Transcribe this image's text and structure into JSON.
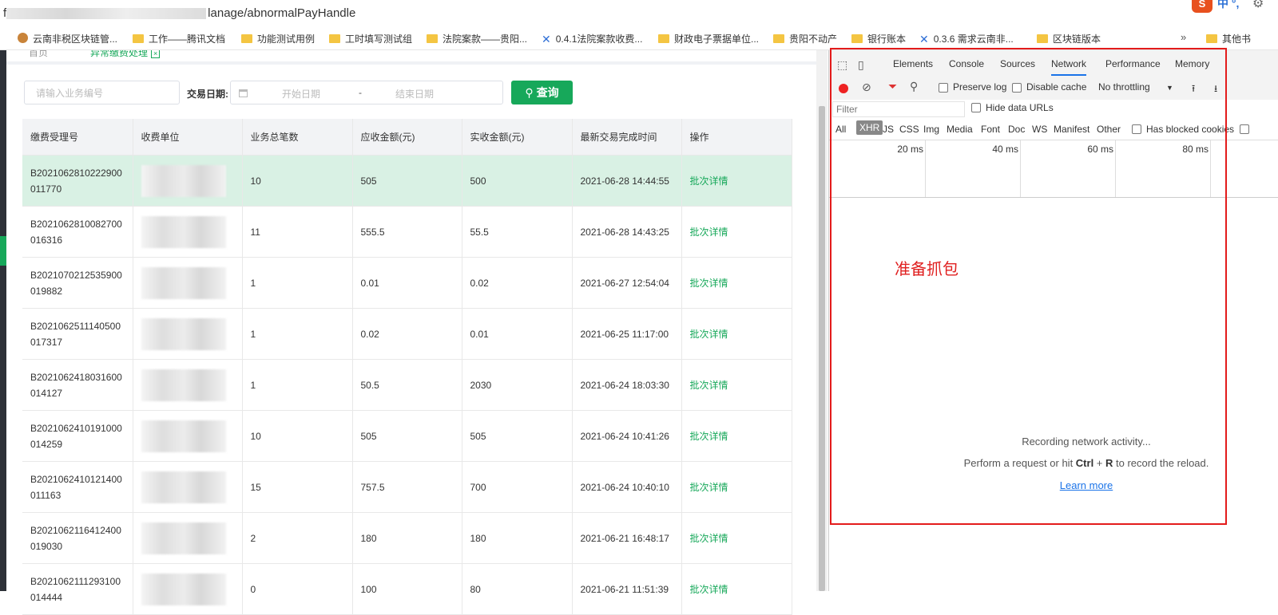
{
  "address_bar": {
    "url_prefix": "f",
    "url_suffix": "lanage/abnormalPayHandle"
  },
  "extension_icons": {
    "sogou": "S",
    "ime": "中 °,",
    "gear": "⚙"
  },
  "bookmarks": [
    {
      "label": "云南非税区块链管...",
      "icon": "circle"
    },
    {
      "label": "工作——腾讯文档",
      "icon": "folder"
    },
    {
      "label": "功能测试用例",
      "icon": "folder"
    },
    {
      "label": "工时填写测试组",
      "icon": "folder"
    },
    {
      "label": "法院案款——贵阳...",
      "icon": "folder"
    },
    {
      "label": "0.4.1法院案款收费...",
      "icon": "jira"
    },
    {
      "label": "财政电子票据单位...",
      "icon": "folder"
    },
    {
      "label": "贵阳不动产",
      "icon": "folder"
    },
    {
      "label": "银行账本",
      "icon": "folder"
    },
    {
      "label": "0.3.6 需求云南非...",
      "icon": "jira"
    },
    {
      "label": "区块链版本",
      "icon": "folder"
    },
    {
      "label": "其他书",
      "icon": "folder"
    }
  ],
  "bookmarks_more": "»",
  "page_tabs": {
    "home": "首页",
    "current": "异常缴费处理",
    "close": "×"
  },
  "filters": {
    "biz_no_placeholder": "请输入业务编号",
    "date_label": "交易日期:",
    "start_placeholder": "开始日期",
    "separator": "-",
    "end_placeholder": "结束日期",
    "query_button": "查询"
  },
  "table": {
    "headers": [
      "缴费受理号",
      "收费单位",
      "业务总笔数",
      "应收金额(元)",
      "实收金额(元)",
      "最新交易完成时间",
      "操作"
    ],
    "rows": [
      {
        "id": [
          "B2021062810222900",
          "011770"
        ],
        "count": "10",
        "due": "505",
        "paid": "500",
        "time": "2021-06-28 14:44:55",
        "op": "批次详情",
        "selected": true
      },
      {
        "id": [
          "B2021062810082700",
          "016316"
        ],
        "count": "11",
        "due": "555.5",
        "paid": "55.5",
        "time": "2021-06-28 14:43:25",
        "op": "批次详情"
      },
      {
        "id": [
          "B2021070212535900",
          "019882"
        ],
        "count": "1",
        "due": "0.01",
        "paid": "0.02",
        "time": "2021-06-27 12:54:04",
        "op": "批次详情"
      },
      {
        "id": [
          "B2021062511140500",
          "017317"
        ],
        "count": "1",
        "due": "0.02",
        "paid": "0.01",
        "time": "2021-06-25 11:17:00",
        "op": "批次详情"
      },
      {
        "id": [
          "B2021062418031600",
          "014127"
        ],
        "count": "1",
        "due": "50.5",
        "paid": "2030",
        "time": "2021-06-24 18:03:30",
        "op": "批次详情"
      },
      {
        "id": [
          "B2021062410191000",
          "014259"
        ],
        "count": "10",
        "due": "505",
        "paid": "505",
        "time": "2021-06-24 10:41:26",
        "op": "批次详情"
      },
      {
        "id": [
          "B2021062410121400",
          "011163"
        ],
        "count": "15",
        "due": "757.5",
        "paid": "700",
        "time": "2021-06-24 10:40:10",
        "op": "批次详情"
      },
      {
        "id": [
          "B2021062116412400",
          "019030"
        ],
        "count": "2",
        "due": "180",
        "paid": "180",
        "time": "2021-06-21 16:48:17",
        "op": "批次详情"
      },
      {
        "id": [
          "B2021062111293100",
          "014444"
        ],
        "count": "0",
        "due": "100",
        "paid": "80",
        "time": "2021-06-21 11:51:39",
        "op": "批次详情"
      }
    ]
  },
  "devtools": {
    "tabs": [
      "Elements",
      "Console",
      "Sources",
      "Network",
      "Performance",
      "Memory"
    ],
    "active_tab": "Network",
    "toolbar": {
      "preserve_log": "Preserve log",
      "disable_cache": "Disable cache",
      "throttling": "No throttling",
      "throttle_arrow": "▼",
      "upload": "⭱",
      "download": "⭳"
    },
    "filter_placeholder": "Filter",
    "hide_data_urls": "Hide data URLs",
    "types": [
      "All",
      "XHR",
      "JS",
      "CSS",
      "Img",
      "Media",
      "Font",
      "Doc",
      "WS",
      "Manifest",
      "Other"
    ],
    "active_type": "XHR",
    "has_blocked_cookies": "Has blocked cookies",
    "timeline_ticks": [
      "20 ms",
      "40 ms",
      "60 ms",
      "80 ms"
    ],
    "recording": "Recording network activity...",
    "hint_before": "Perform a request or hit ",
    "hint_ctrl": "Ctrl",
    "hint_plus": " + ",
    "hint_r": "R",
    "hint_after": " to record the reload.",
    "learn_more": "Learn more"
  },
  "annotation": "准备抓包",
  "colors": {
    "primary": "#17a85a",
    "selected_row": "#d9f1e4",
    "annotation": "#e31b1b",
    "devtools_link": "#1a73e8"
  }
}
